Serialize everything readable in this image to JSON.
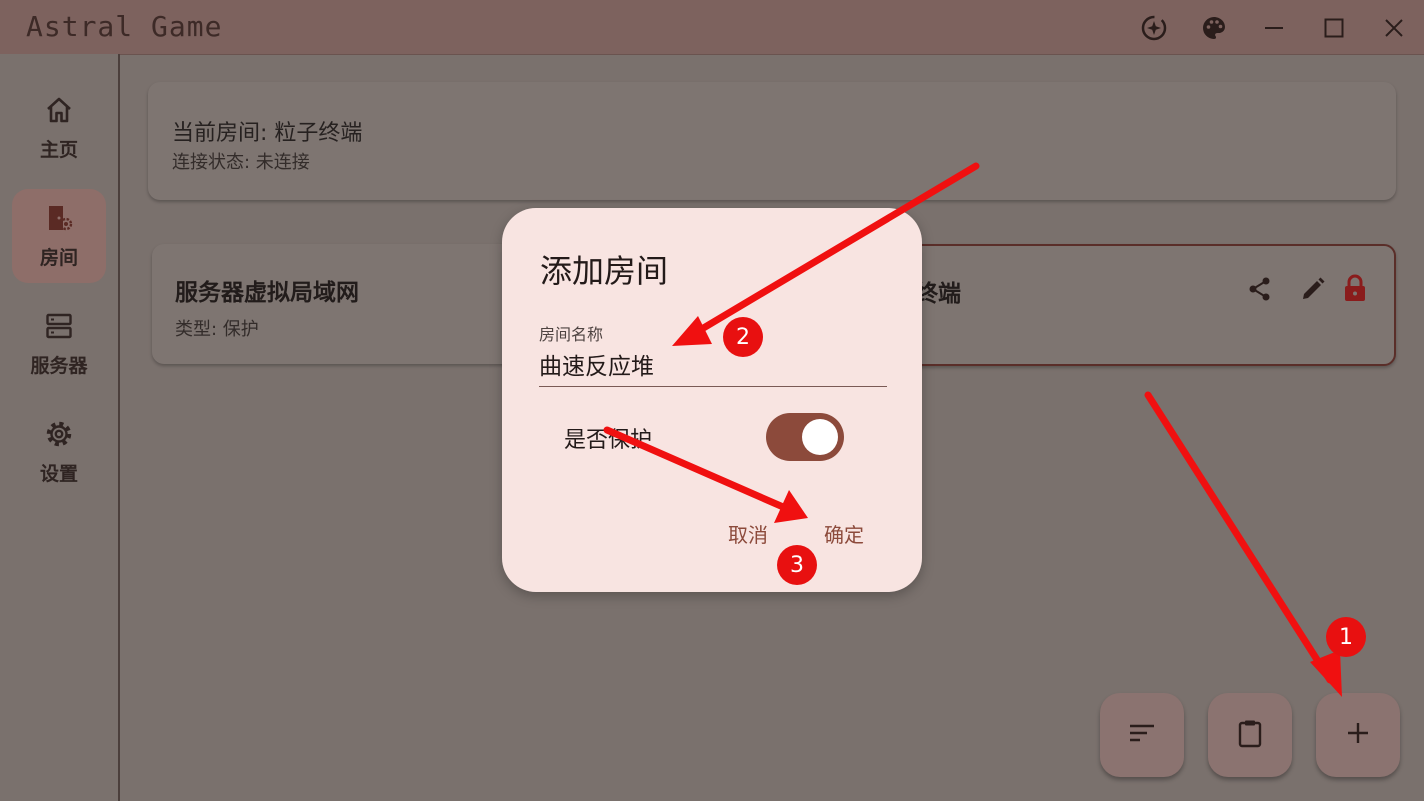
{
  "window": {
    "title": "Astral Game"
  },
  "titlebar_icons": [
    "sparkle-refresh-icon",
    "palette-icon",
    "minimize-icon",
    "maximize-icon",
    "close-icon"
  ],
  "nav": {
    "items": [
      {
        "label": "主页",
        "icon": "home-icon",
        "active": false
      },
      {
        "label": "房间",
        "icon": "room-door-gear-icon",
        "active": true
      },
      {
        "label": "服务器",
        "icon": "server-icon",
        "active": false
      },
      {
        "label": "设置",
        "icon": "settings-gear-icon",
        "active": false
      }
    ]
  },
  "status_card": {
    "current_room": "当前房间: 粒子终端",
    "connection_status": "连接状态: 未连接"
  },
  "rooms": [
    {
      "name": "服务器虚拟局域网",
      "type": "类型: 保护"
    },
    {
      "name_visible": "终端"
    }
  ],
  "fab": {
    "icons": [
      "sort-icon",
      "clipboard-icon",
      "add-icon"
    ]
  },
  "dialog": {
    "title": "添加房间",
    "field_label": "房间名称",
    "field_value": "曲速反应堆",
    "switch_label": "是否保护",
    "switch_on": true,
    "cancel_label": "取消",
    "confirm_label": "确定"
  },
  "annotations": {
    "badges": [
      "1",
      "2",
      "3"
    ],
    "color": "#e81010"
  },
  "colors": {
    "accent": "#8c4a3b",
    "dialog_bg": "#f8e4e1",
    "scrim": "#7a716d"
  }
}
